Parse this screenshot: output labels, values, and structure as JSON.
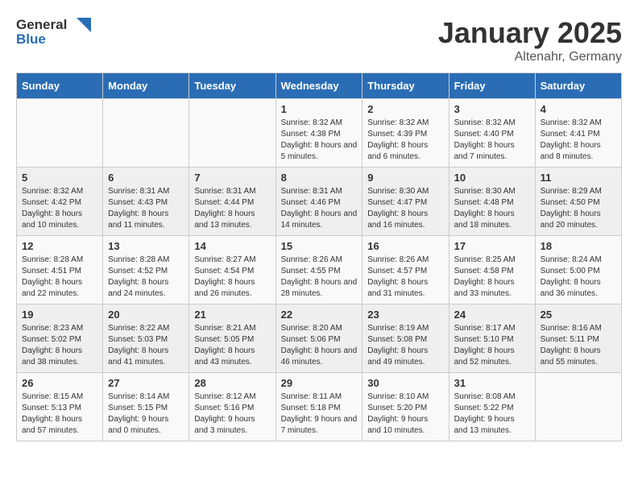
{
  "header": {
    "logo": {
      "general": "General",
      "blue": "Blue"
    },
    "title": "January 2025",
    "location": "Altenahr, Germany"
  },
  "weekdays": [
    "Sunday",
    "Monday",
    "Tuesday",
    "Wednesday",
    "Thursday",
    "Friday",
    "Saturday"
  ],
  "weeks": [
    [
      {
        "day": "",
        "sunrise": "",
        "sunset": "",
        "daylight": ""
      },
      {
        "day": "",
        "sunrise": "",
        "sunset": "",
        "daylight": ""
      },
      {
        "day": "",
        "sunrise": "",
        "sunset": "",
        "daylight": ""
      },
      {
        "day": "1",
        "sunrise": "Sunrise: 8:32 AM",
        "sunset": "Sunset: 4:38 PM",
        "daylight": "Daylight: 8 hours and 5 minutes."
      },
      {
        "day": "2",
        "sunrise": "Sunrise: 8:32 AM",
        "sunset": "Sunset: 4:39 PM",
        "daylight": "Daylight: 8 hours and 6 minutes."
      },
      {
        "day": "3",
        "sunrise": "Sunrise: 8:32 AM",
        "sunset": "Sunset: 4:40 PM",
        "daylight": "Daylight: 8 hours and 7 minutes."
      },
      {
        "day": "4",
        "sunrise": "Sunrise: 8:32 AM",
        "sunset": "Sunset: 4:41 PM",
        "daylight": "Daylight: 8 hours and 8 minutes."
      }
    ],
    [
      {
        "day": "5",
        "sunrise": "Sunrise: 8:32 AM",
        "sunset": "Sunset: 4:42 PM",
        "daylight": "Daylight: 8 hours and 10 minutes."
      },
      {
        "day": "6",
        "sunrise": "Sunrise: 8:31 AM",
        "sunset": "Sunset: 4:43 PM",
        "daylight": "Daylight: 8 hours and 11 minutes."
      },
      {
        "day": "7",
        "sunrise": "Sunrise: 8:31 AM",
        "sunset": "Sunset: 4:44 PM",
        "daylight": "Daylight: 8 hours and 13 minutes."
      },
      {
        "day": "8",
        "sunrise": "Sunrise: 8:31 AM",
        "sunset": "Sunset: 4:46 PM",
        "daylight": "Daylight: 8 hours and 14 minutes."
      },
      {
        "day": "9",
        "sunrise": "Sunrise: 8:30 AM",
        "sunset": "Sunset: 4:47 PM",
        "daylight": "Daylight: 8 hours and 16 minutes."
      },
      {
        "day": "10",
        "sunrise": "Sunrise: 8:30 AM",
        "sunset": "Sunset: 4:48 PM",
        "daylight": "Daylight: 8 hours and 18 minutes."
      },
      {
        "day": "11",
        "sunrise": "Sunrise: 8:29 AM",
        "sunset": "Sunset: 4:50 PM",
        "daylight": "Daylight: 8 hours and 20 minutes."
      }
    ],
    [
      {
        "day": "12",
        "sunrise": "Sunrise: 8:28 AM",
        "sunset": "Sunset: 4:51 PM",
        "daylight": "Daylight: 8 hours and 22 minutes."
      },
      {
        "day": "13",
        "sunrise": "Sunrise: 8:28 AM",
        "sunset": "Sunset: 4:52 PM",
        "daylight": "Daylight: 8 hours and 24 minutes."
      },
      {
        "day": "14",
        "sunrise": "Sunrise: 8:27 AM",
        "sunset": "Sunset: 4:54 PM",
        "daylight": "Daylight: 8 hours and 26 minutes."
      },
      {
        "day": "15",
        "sunrise": "Sunrise: 8:26 AM",
        "sunset": "Sunset: 4:55 PM",
        "daylight": "Daylight: 8 hours and 28 minutes."
      },
      {
        "day": "16",
        "sunrise": "Sunrise: 8:26 AM",
        "sunset": "Sunset: 4:57 PM",
        "daylight": "Daylight: 8 hours and 31 minutes."
      },
      {
        "day": "17",
        "sunrise": "Sunrise: 8:25 AM",
        "sunset": "Sunset: 4:58 PM",
        "daylight": "Daylight: 8 hours and 33 minutes."
      },
      {
        "day": "18",
        "sunrise": "Sunrise: 8:24 AM",
        "sunset": "Sunset: 5:00 PM",
        "daylight": "Daylight: 8 hours and 36 minutes."
      }
    ],
    [
      {
        "day": "19",
        "sunrise": "Sunrise: 8:23 AM",
        "sunset": "Sunset: 5:02 PM",
        "daylight": "Daylight: 8 hours and 38 minutes."
      },
      {
        "day": "20",
        "sunrise": "Sunrise: 8:22 AM",
        "sunset": "Sunset: 5:03 PM",
        "daylight": "Daylight: 8 hours and 41 minutes."
      },
      {
        "day": "21",
        "sunrise": "Sunrise: 8:21 AM",
        "sunset": "Sunset: 5:05 PM",
        "daylight": "Daylight: 8 hours and 43 minutes."
      },
      {
        "day": "22",
        "sunrise": "Sunrise: 8:20 AM",
        "sunset": "Sunset: 5:06 PM",
        "daylight": "Daylight: 8 hours and 46 minutes."
      },
      {
        "day": "23",
        "sunrise": "Sunrise: 8:19 AM",
        "sunset": "Sunset: 5:08 PM",
        "daylight": "Daylight: 8 hours and 49 minutes."
      },
      {
        "day": "24",
        "sunrise": "Sunrise: 8:17 AM",
        "sunset": "Sunset: 5:10 PM",
        "daylight": "Daylight: 8 hours and 52 minutes."
      },
      {
        "day": "25",
        "sunrise": "Sunrise: 8:16 AM",
        "sunset": "Sunset: 5:11 PM",
        "daylight": "Daylight: 8 hours and 55 minutes."
      }
    ],
    [
      {
        "day": "26",
        "sunrise": "Sunrise: 8:15 AM",
        "sunset": "Sunset: 5:13 PM",
        "daylight": "Daylight: 8 hours and 57 minutes."
      },
      {
        "day": "27",
        "sunrise": "Sunrise: 8:14 AM",
        "sunset": "Sunset: 5:15 PM",
        "daylight": "Daylight: 9 hours and 0 minutes."
      },
      {
        "day": "28",
        "sunrise": "Sunrise: 8:12 AM",
        "sunset": "Sunset: 5:16 PM",
        "daylight": "Daylight: 9 hours and 3 minutes."
      },
      {
        "day": "29",
        "sunrise": "Sunrise: 8:11 AM",
        "sunset": "Sunset: 5:18 PM",
        "daylight": "Daylight: 9 hours and 7 minutes."
      },
      {
        "day": "30",
        "sunrise": "Sunrise: 8:10 AM",
        "sunset": "Sunset: 5:20 PM",
        "daylight": "Daylight: 9 hours and 10 minutes."
      },
      {
        "day": "31",
        "sunrise": "Sunrise: 8:08 AM",
        "sunset": "Sunset: 5:22 PM",
        "daylight": "Daylight: 9 hours and 13 minutes."
      },
      {
        "day": "",
        "sunrise": "",
        "sunset": "",
        "daylight": ""
      }
    ]
  ]
}
